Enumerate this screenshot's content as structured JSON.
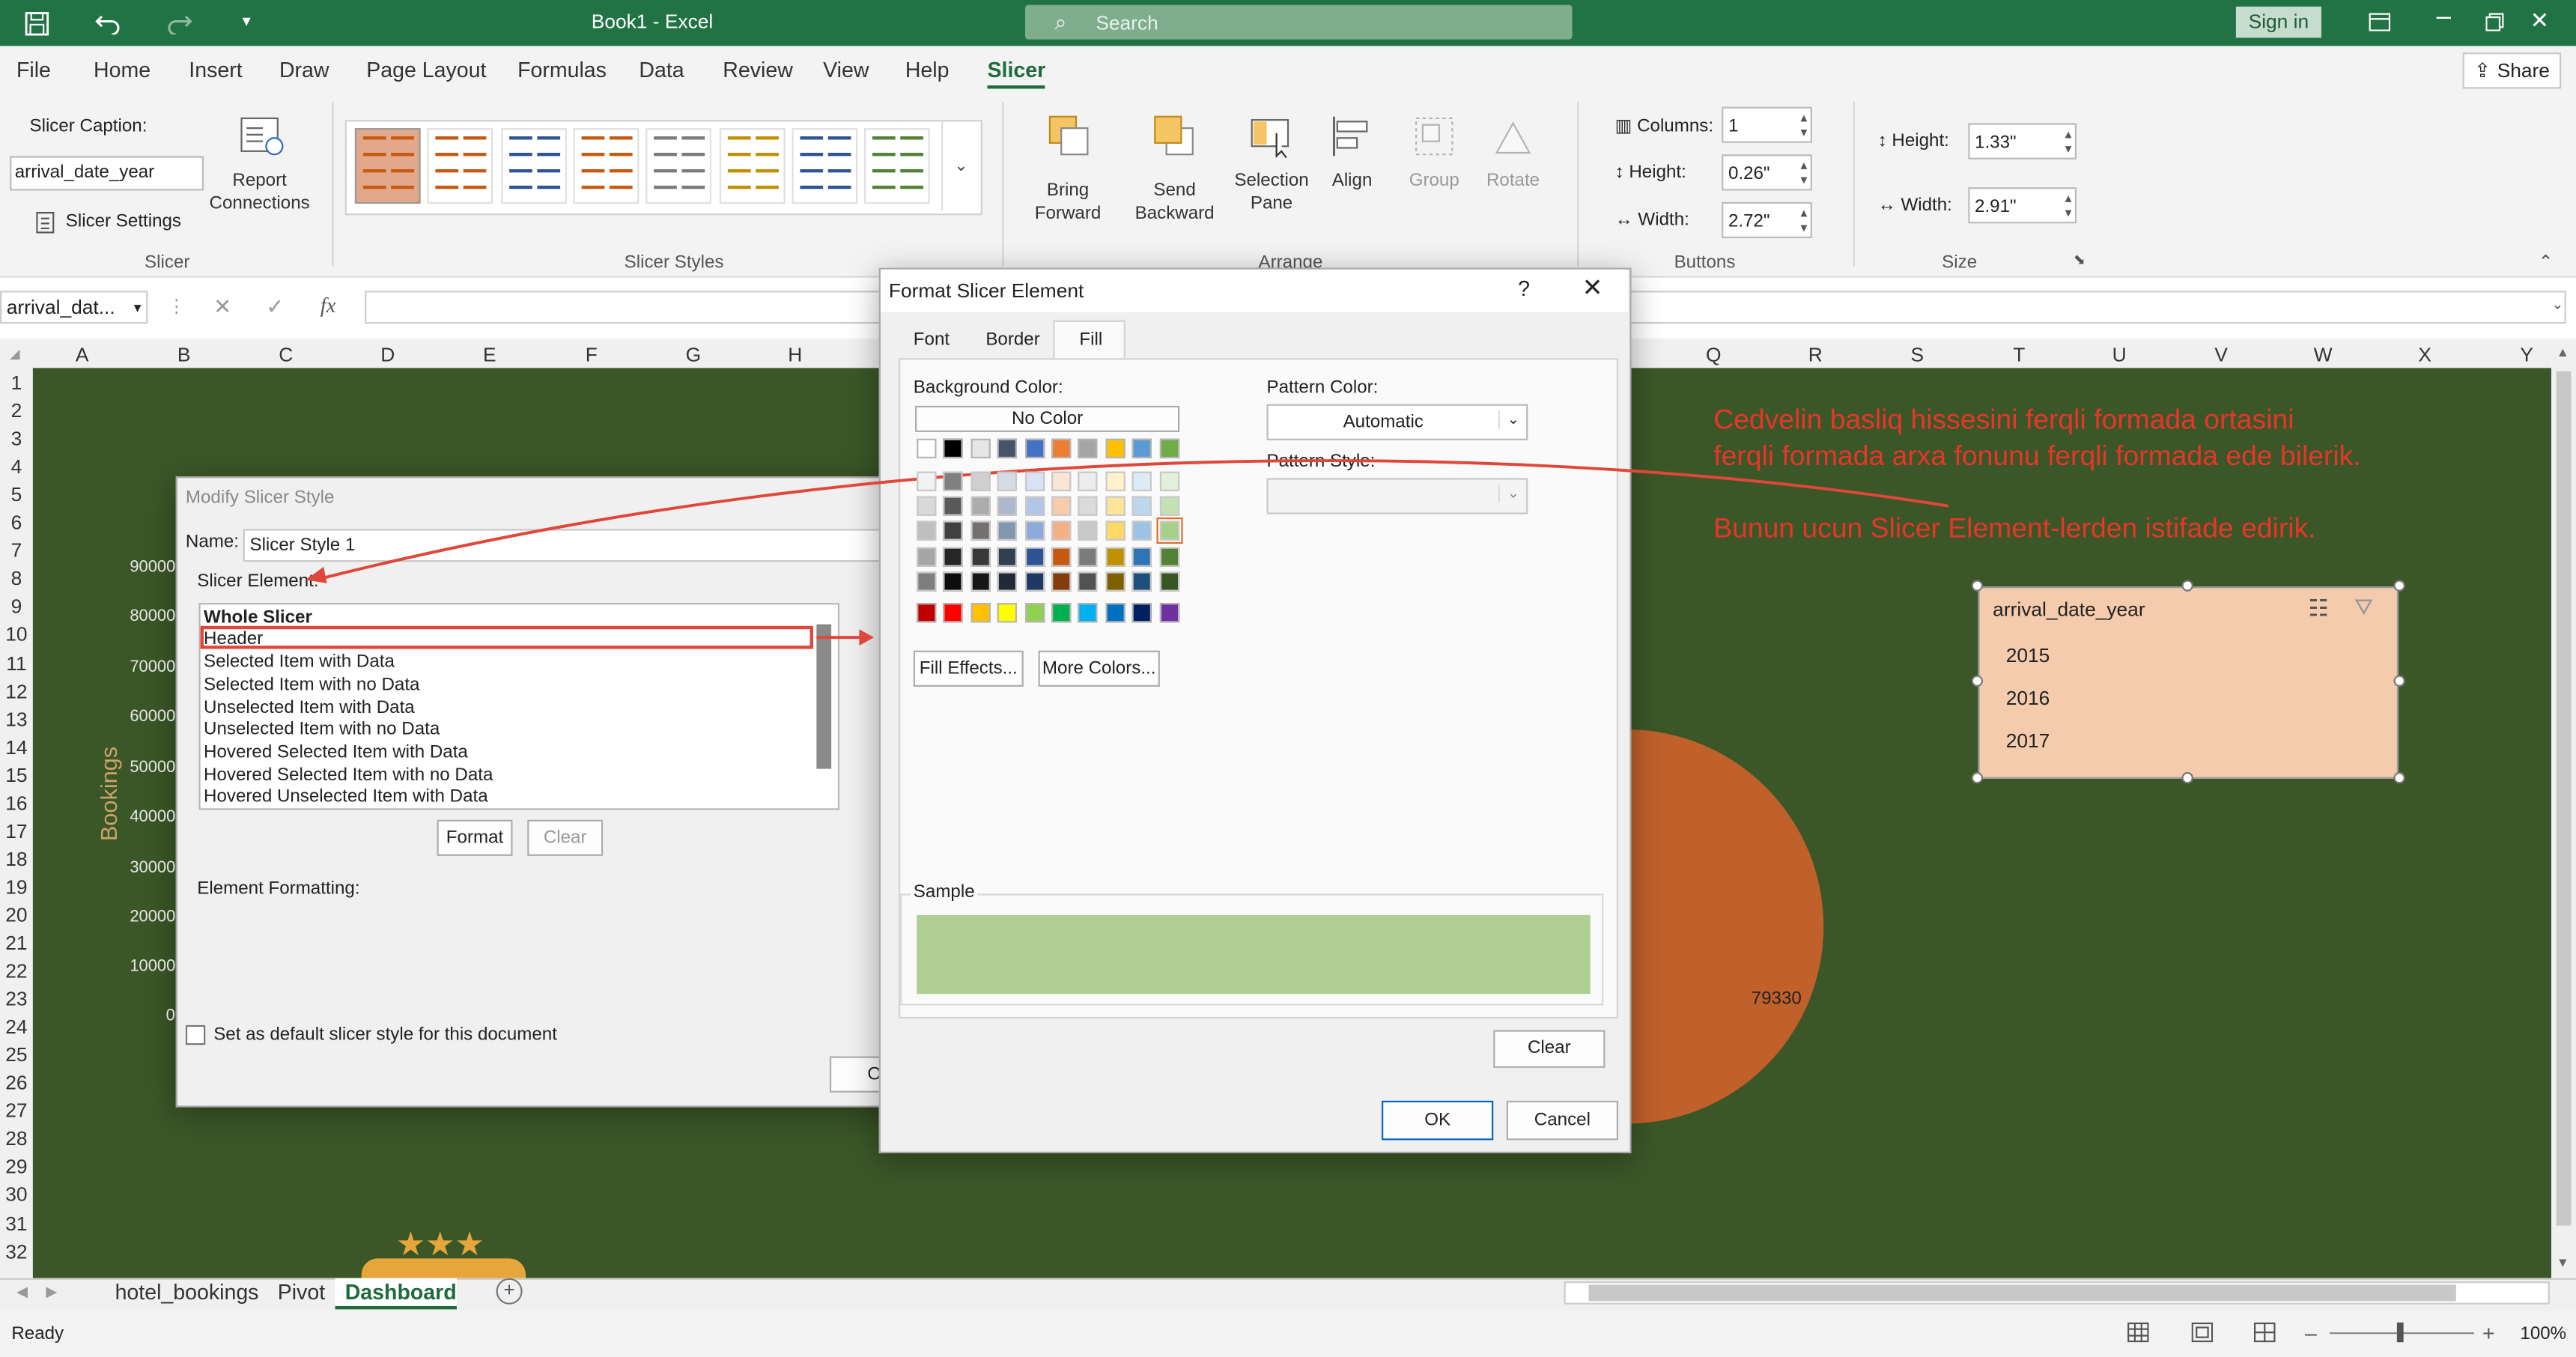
{
  "titlebar": {
    "doc_title": "Book1  -  Excel",
    "search_placeholder": "Search",
    "signin_label": "Sign in",
    "share_label": "Share"
  },
  "menu": {
    "items": [
      "File",
      "Home",
      "Insert",
      "Draw",
      "Page Layout",
      "Formulas",
      "Data",
      "Review",
      "View",
      "Help",
      "Slicer"
    ],
    "active": "Slicer"
  },
  "ribbon": {
    "slicer_group": {
      "caption_label": "Slicer Caption:",
      "caption_value": "arrival_date_year",
      "report_connections": "Report Connections",
      "settings": "Slicer Settings",
      "group_label": "Slicer"
    },
    "styles_group": {
      "group_label": "Slicer Styles"
    },
    "arrange_group": {
      "bring_forward": "Bring Forward",
      "send_backward": "Send Backward",
      "selection_pane": "Selection Pane",
      "align": "Align",
      "group": "Group",
      "rotate": "Rotate",
      "group_label": "Arrange"
    },
    "buttons_group": {
      "columns_label": "Columns:",
      "columns_value": "1",
      "height_label": "Height:",
      "height_value": "0.26\"",
      "width_label": "Width:",
      "width_value": "2.72\"",
      "group_label": "Buttons"
    },
    "size_group": {
      "height_label": "Height:",
      "height_value": "1.33\"",
      "width_label": "Width:",
      "width_value": "2.91\"",
      "group_label": "Size"
    }
  },
  "formula_bar": {
    "name_box": "arrival_dat..."
  },
  "grid": {
    "columns": [
      "A",
      "B",
      "C",
      "D",
      "E",
      "F",
      "G",
      "H",
      "Q",
      "R",
      "S",
      "T",
      "U",
      "V",
      "W",
      "X",
      "Y"
    ],
    "rows": [
      "1",
      "2",
      "3",
      "4",
      "5",
      "6",
      "7",
      "8",
      "9",
      "10",
      "11",
      "12",
      "13",
      "14",
      "15",
      "16",
      "17",
      "18",
      "19",
      "20",
      "21",
      "22",
      "23",
      "24",
      "25",
      "26",
      "27",
      "28",
      "29",
      "30",
      "31",
      "32"
    ]
  },
  "background_chart": {
    "ylabel": "Bookings",
    "yticks": [
      "90000",
      "80000",
      "70000",
      "60000",
      "50000",
      "40000",
      "30000",
      "20000",
      "10000",
      "0"
    ],
    "pie_label": "79330",
    "stars": "★★★"
  },
  "modify_dialog": {
    "title": "Modify Slicer Style",
    "name_label": "Name:",
    "name_value": "Slicer Style 1",
    "element_label": "Slicer Element:",
    "elements": [
      "Whole Slicer",
      "Header",
      "Selected Item with Data",
      "Selected Item with no Data",
      "Unselected Item with Data",
      "Unselected Item with no Data",
      "Hovered Selected Item with Data",
      "Hovered Selected Item with no Data",
      "Hovered Unselected Item with Data"
    ],
    "selected_element": "Header",
    "format_button": "Format",
    "clear_button": "Clear",
    "element_formatting": "Element Formatting:",
    "default_checkbox": "Set as default slicer style for this document",
    "ok_partial": "O"
  },
  "format_dialog": {
    "title": "Format Slicer Element",
    "help": "?",
    "close": "✕",
    "tabs": [
      "Font",
      "Border",
      "Fill"
    ],
    "active_tab": "Fill",
    "background_color_label": "Background Color:",
    "no_color": "No Color",
    "pattern_color_label": "Pattern Color:",
    "pattern_color_value": "Automatic",
    "pattern_style_label": "Pattern Style:",
    "fill_effects": "Fill Effects...",
    "more_colors": "More Colors...",
    "sample_label": "Sample",
    "sample_color": "#b0d093",
    "clear_button": "Clear",
    "ok_button": "OK",
    "cancel_button": "Cancel",
    "palette_theme_row": [
      "#ffffff",
      "#000000",
      "#e7e6e6",
      "#44546a",
      "#4472c4",
      "#ed7d31",
      "#a5a5a5",
      "#ffc000",
      "#5b9bd5",
      "#70ad47"
    ],
    "palette_shades": [
      [
        "#f2f2f2",
        "#808080",
        "#d0cece",
        "#d6dce4",
        "#d9e2f3",
        "#fbe5d5",
        "#ededed",
        "#fff2cc",
        "#ddebf7",
        "#e2efd9"
      ],
      [
        "#d9d9d9",
        "#595959",
        "#aeabab",
        "#adb9ca",
        "#b4c6e7",
        "#f7cbac",
        "#dbdbdb",
        "#fee599",
        "#bdd7ee",
        "#c5e0b3"
      ],
      [
        "#bfbfbf",
        "#404040",
        "#757070",
        "#8496b0",
        "#8eaadb",
        "#f4b183",
        "#c9c9c9",
        "#ffd965",
        "#9cc3e5",
        "#a8d08d"
      ],
      [
        "#a6a6a6",
        "#262626",
        "#3a3838",
        "#323f4f",
        "#2f5496",
        "#c55a11",
        "#7b7b7b",
        "#bf9000",
        "#2e75b5",
        "#538135"
      ],
      [
        "#7f7f7f",
        "#0d0d0d",
        "#171616",
        "#222a35",
        "#1f3864",
        "#833c0b",
        "#525252",
        "#7f6000",
        "#1e4e79",
        "#375623"
      ]
    ],
    "palette_standard": [
      "#c00000",
      "#ff0000",
      "#ffc000",
      "#ffff00",
      "#92d050",
      "#00b050",
      "#00b0f0",
      "#0070c0",
      "#002060",
      "#7030a0"
    ]
  },
  "annotation": {
    "line1": "Cedvelin basliq hissesini ferqli formada ortasini",
    "line2": "ferqli formada arxa fonunu ferqli formada ede bilerik.",
    "line3": "Bunun ucun Slicer Element-lerden istifade edirik."
  },
  "slicer": {
    "header": "arrival_date_year",
    "items": [
      "2015",
      "2016",
      "2017"
    ]
  },
  "sheet_tabs": {
    "items": [
      "hotel_bookings",
      "Pivot",
      "Dashboard"
    ],
    "active": "Dashboard"
  },
  "status": {
    "ready": "Ready",
    "zoom": "100%"
  }
}
